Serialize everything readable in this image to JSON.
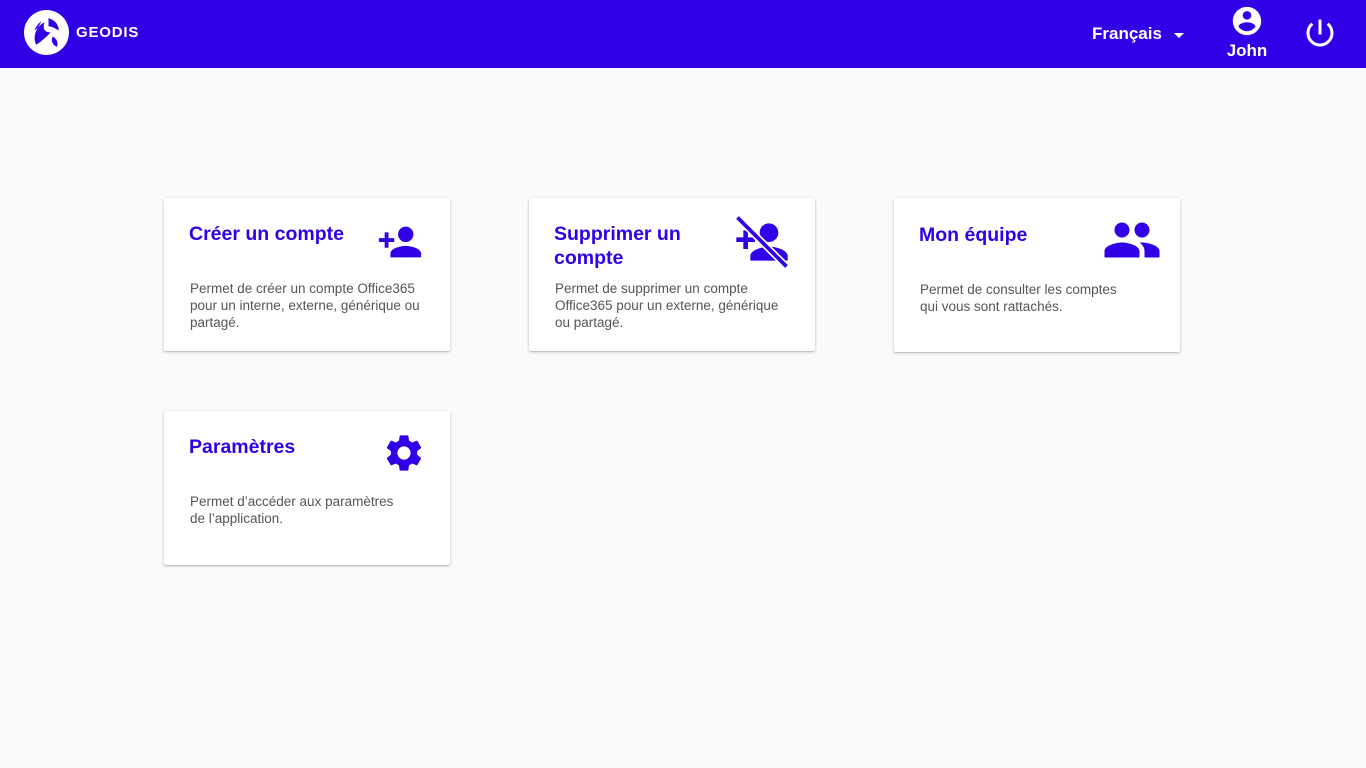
{
  "header": {
    "brand": "GEODIS",
    "language": "Français",
    "user_name": "John"
  },
  "colors": {
    "primary": "#3000e6",
    "background": "#fafafa",
    "card": "#ffffff",
    "text_secondary": "#555555"
  },
  "cards": [
    {
      "title": "Créer un compte",
      "icon": "person-add-icon",
      "description": "Permet de créer un compte Office365 pour un interne, externe, générique ou partagé."
    },
    {
      "title": "Supprimer un compte",
      "icon": "person-add-disabled-icon",
      "description": "Permet de supprimer un compte Office365 pour un externe, générique ou partagé."
    },
    {
      "title": "Mon équipe",
      "icon": "people-icon",
      "description": "Permet de consulter les comptes qui vous sont rattachés."
    },
    {
      "title": "Paramètres",
      "icon": "settings-gear-icon",
      "description": "Permet d’accéder aux paramètres de l’application."
    }
  ]
}
